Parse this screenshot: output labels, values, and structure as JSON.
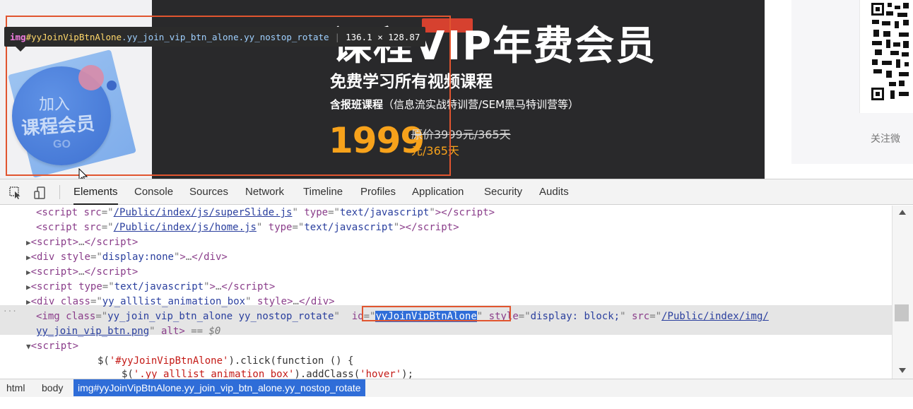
{
  "banner": {
    "title": "课程VIP年费会员",
    "subtitle": "免费学习所有视频课程",
    "note_bold": "含报班课程",
    "note_rest": "（信息流实战特训营/SEM黑马特训营等）",
    "price": "1999",
    "price_old": "原价3999元/365天",
    "price_unit": "元/365天"
  },
  "right_panel": {
    "follow_text": "关注微"
  },
  "vip_badge": {
    "line1": "加入",
    "line2": "课程会员",
    "go": "GO"
  },
  "tooltip": {
    "tag": "img",
    "id": "#yyJoinVipBtnAlone",
    "classes": ".yy_join_vip_btn_alone.yy_nostop_rotate",
    "size": "136.1 × 128.87"
  },
  "devtools": {
    "tabs": [
      "Elements",
      "Console",
      "Sources",
      "Network",
      "Timeline",
      "Profiles",
      "Application",
      "Security",
      "Audits"
    ],
    "code": {
      "l1_src": "/Public/index/js/superSlide.js",
      "l2_src": "/Public/index/js/home.js",
      "type_js": "text/javascript",
      "display_none": "display:none",
      "alllist_class": "yy_alllist_animation_box",
      "img_class": "yy_join_vip_btn_alone yy_nostop_rotate",
      "img_id": "yyJoinVipBtnAlone",
      "img_style": "display: block;",
      "img_src_1": "/Public/index/img/",
      "img_src_2": "yy_join_vip_btn.png",
      "eq_marker": "== $0",
      "js_line1_pre": "$(",
      "js_line1_sel": "'#yyJoinVipBtnAlone'",
      "js_line1_post": ").click(function () {",
      "js_line2_pre": "$(",
      "js_line2_sel": "'.yy_alllist_animation_box'",
      "js_line2_mid": ").addClass(",
      "js_line2_arg": "'hover'",
      "js_line2_post": ");"
    },
    "breadcrumbs": [
      "html",
      "body",
      "img#yyJoinVipBtnAlone.yy_join_vip_btn_alone.yy_nostop_rotate"
    ]
  }
}
